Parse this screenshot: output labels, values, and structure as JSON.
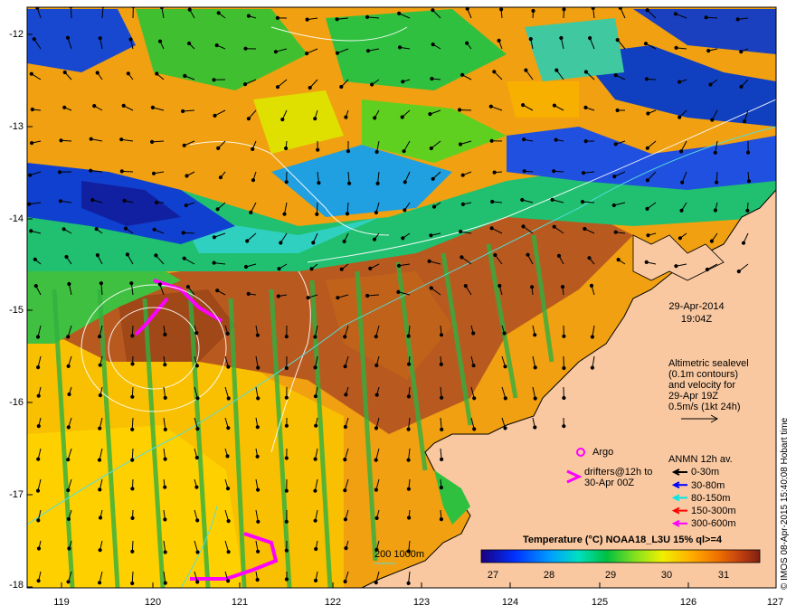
{
  "map": {
    "date": "29-Apr-2014",
    "time": "19:04Z",
    "altimetry_note": [
      "Altimetric sealevel",
      "(0.1m contours)",
      "and velocity for",
      "29-Apr 19Z",
      "0.5m/s (1kt 24h)"
    ],
    "argo_label": "Argo",
    "drifters_label": [
      "drifters@12h to",
      "30-Apr 00Z"
    ],
    "anmn_title": "ANMN 12h av.",
    "anmn_depths": [
      {
        "label": "0-30m",
        "color": "#000000"
      },
      {
        "label": "30-80m",
        "color": "#0000ff"
      },
      {
        "label": "80-150m",
        "color": "#00e5e5"
      },
      {
        "label": "150-300m",
        "color": "#ff0000"
      },
      {
        "label": "300-600m",
        "color": "#ff00ff"
      }
    ],
    "isobath_label": "200  1000m",
    "colorbar_title": "Temperature (°C) NOAA18_L3U 15% ql>=4",
    "colorbar_ticks": [
      "27",
      "28",
      "29",
      "30",
      "31"
    ],
    "credit": "© IMOS 08-Apr-2015 15:40:08 Hobart time",
    "lat_ticks": [
      "-12",
      "-13",
      "-14",
      "-15",
      "-16",
      "-17",
      "-18"
    ],
    "lon_ticks": [
      "119",
      "120",
      "121",
      "122",
      "123",
      "124",
      "125",
      "126",
      "127"
    ],
    "colors": {
      "land": "#f9c8a0",
      "isobath": "#55dddd",
      "contour": "#ffffff",
      "argo": "#ff00ff"
    }
  }
}
